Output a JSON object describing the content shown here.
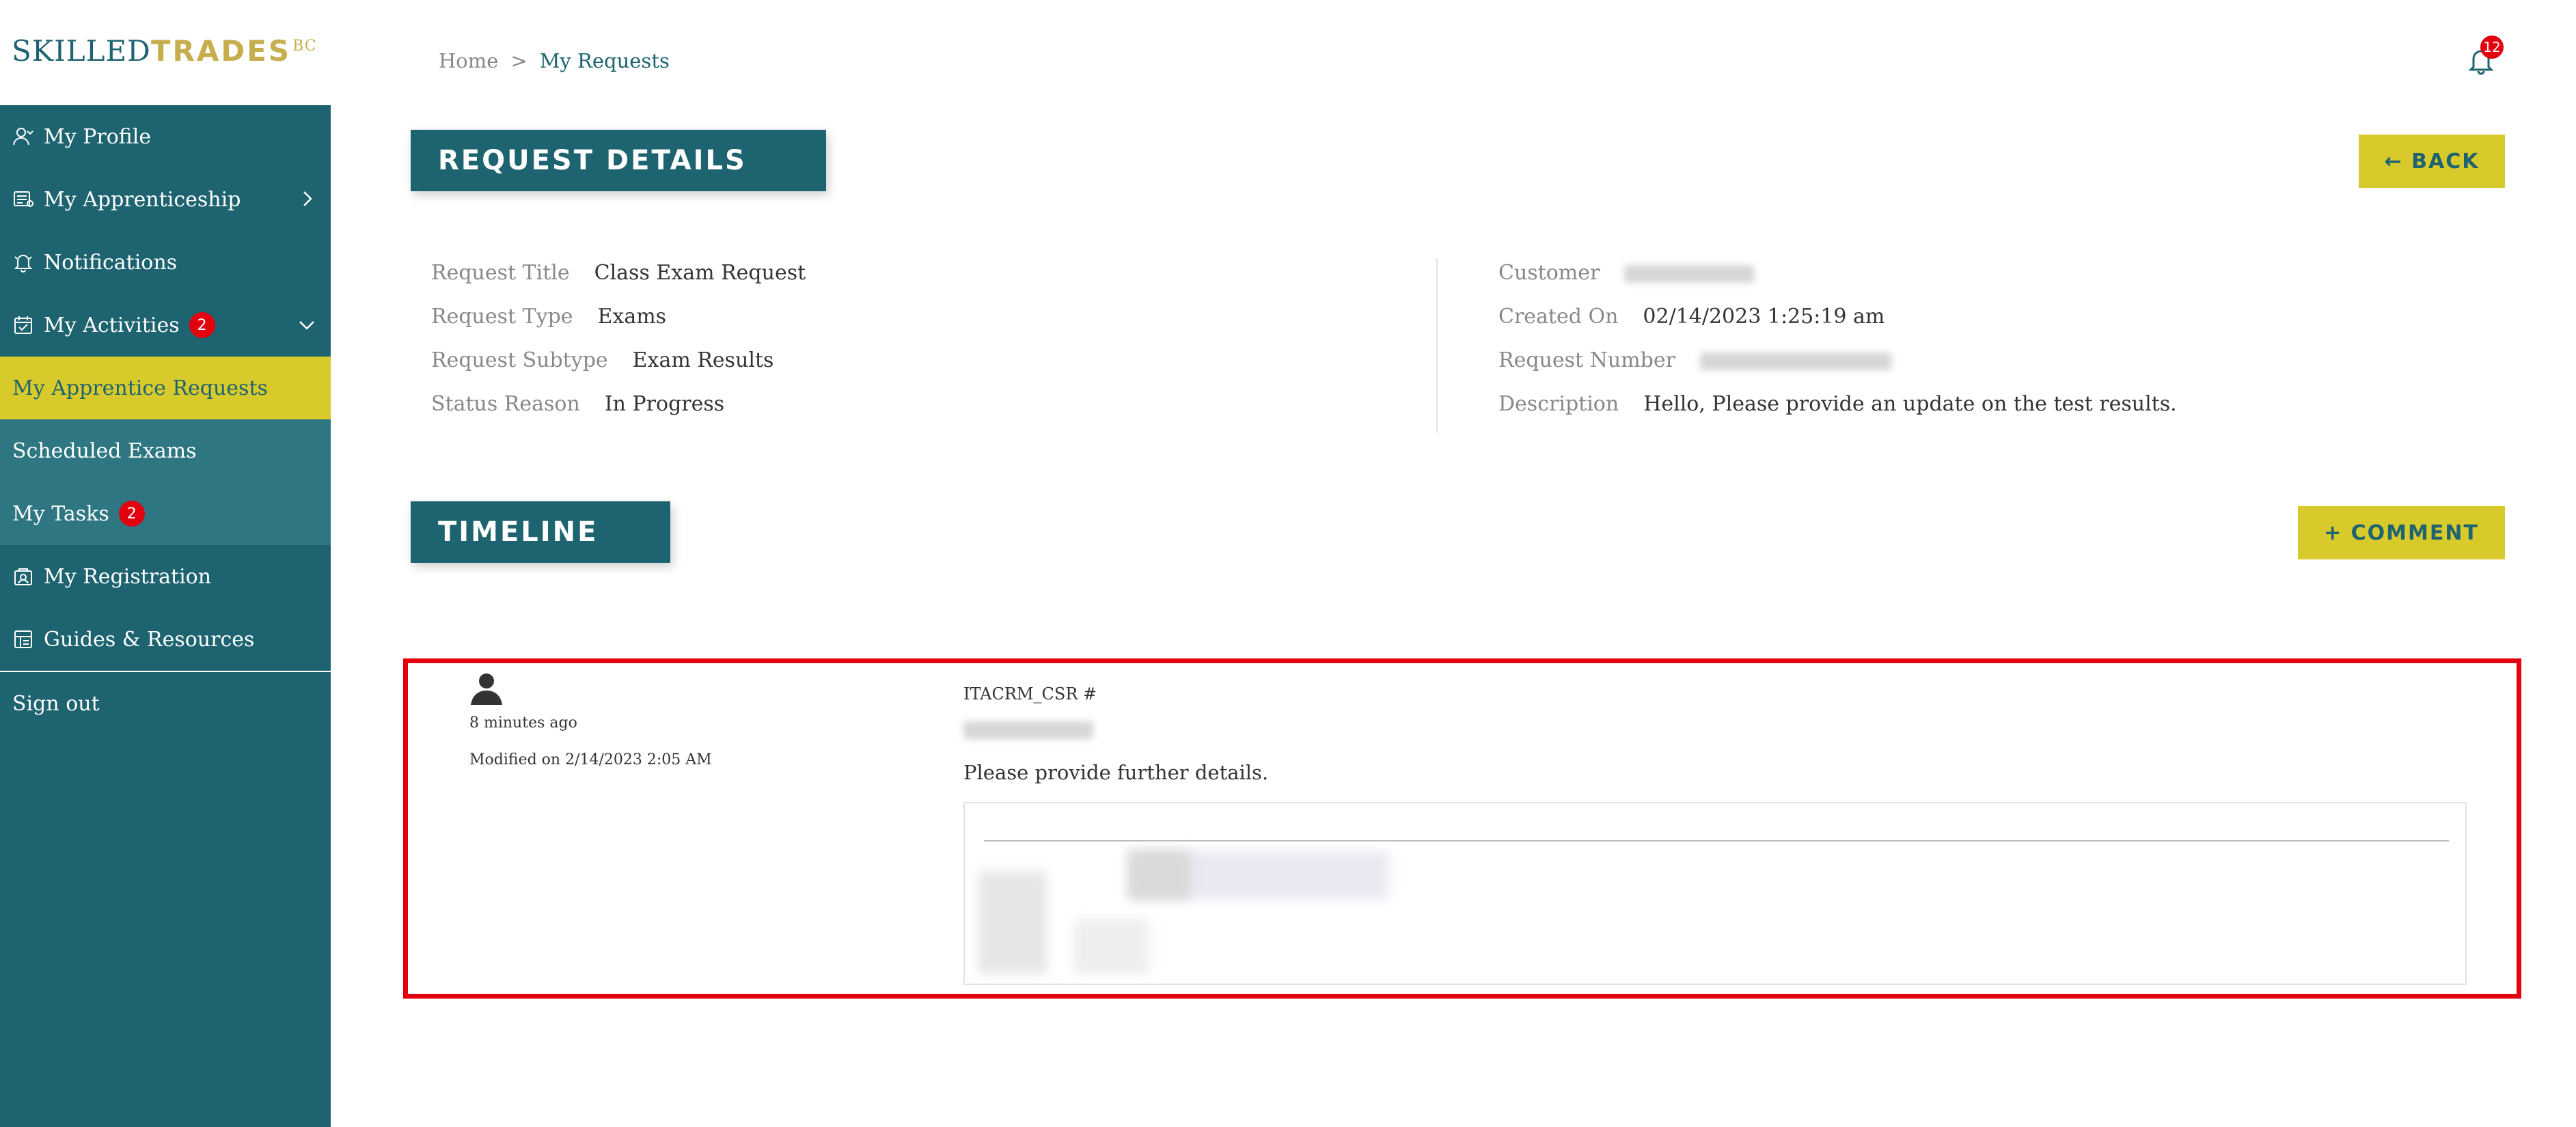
{
  "logo": {
    "part1": "SKILLED",
    "part2": "TRADES",
    "part3": "BC"
  },
  "sidebar": {
    "items": [
      {
        "label": "My Profile",
        "icon": "user-icon"
      },
      {
        "label": "My Apprenticeship",
        "icon": "apprenticeship-icon"
      },
      {
        "label": "Notifications",
        "icon": "bell-icon"
      },
      {
        "label": "My Activities",
        "icon": "activities-icon",
        "badge": "2"
      },
      {
        "label": "My Apprentice Requests",
        "active": true
      },
      {
        "label": "Scheduled Exams"
      },
      {
        "label": "My Tasks",
        "badge": "2"
      },
      {
        "label": "My Registration",
        "icon": "registration-icon"
      },
      {
        "label": "Guides & Resources",
        "icon": "guides-icon"
      },
      {
        "label": "Sign out"
      }
    ]
  },
  "breadcrumb": {
    "home": "Home",
    "separator": ">",
    "current": "My Requests"
  },
  "header": {
    "notification_count": "12"
  },
  "request_details": {
    "title": "REQUEST DETAILS",
    "back_label": "← BACK",
    "fields": {
      "request_title": {
        "label": "Request Title",
        "value": "Class Exam Request"
      },
      "request_type": {
        "label": "Request Type",
        "value": "Exams"
      },
      "request_subtype": {
        "label": "Request Subtype",
        "value": "Exam Results"
      },
      "status_reason": {
        "label": "Status Reason",
        "value": "In Progress"
      },
      "customer": {
        "label": "Customer"
      },
      "created_on": {
        "label": "Created On",
        "value": "02/14/2023 1:25:19 am"
      },
      "request_number": {
        "label": "Request Number"
      },
      "description": {
        "label": "Description",
        "value": "Hello, Please provide an update on the test results."
      }
    }
  },
  "timeline": {
    "title": "TIMELINE",
    "comment_label": "+ COMMENT",
    "entries": [
      {
        "time_ago": "8 minutes ago",
        "modified": "Modified on 2/14/2023 2:05 AM",
        "author": "ITACRM_CSR #",
        "message": "Please provide further details."
      }
    ]
  },
  "colors": {
    "primary": "#1d6370",
    "accent": "#d9ca2c",
    "alert": "#e3000f"
  }
}
